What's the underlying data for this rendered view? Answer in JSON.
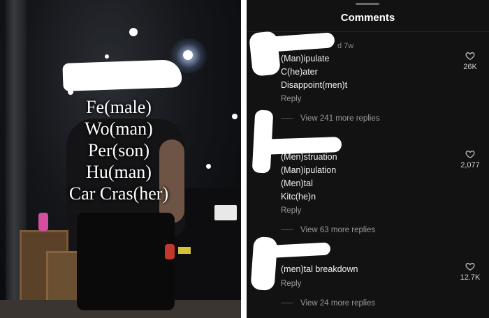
{
  "video": {
    "caption_lines": [
      "Fe(male)",
      "Wo(man)",
      "Per(son)",
      "Hu(man)",
      "Car Cras(her)"
    ]
  },
  "comments_panel": {
    "title": "Comments",
    "comments": [
      {
        "timestamp": "d 7w",
        "lines": [
          "(Man)ipulate",
          "C(he)ater",
          "Disappoint(men)t"
        ],
        "reply_label": "Reply",
        "likes": "26K",
        "view_replies": "View 241 more replies"
      },
      {
        "timestamp": "",
        "lines": [
          "(Men)struation",
          "(Man)ipulation",
          "(Men)tal",
          "Kitc(he)n"
        ],
        "reply_label": "Reply",
        "likes": "2,077",
        "view_replies": "View 63 more replies"
      },
      {
        "timestamp": "",
        "lines": [
          "(men)tal breakdown"
        ],
        "reply_label": "Reply",
        "likes": "12.7K",
        "view_replies": "View 24 more replies"
      }
    ]
  },
  "colors": {
    "panel_bg": "#121212",
    "text_primary": "#f2f2f2",
    "text_secondary": "#9a9a9a"
  }
}
